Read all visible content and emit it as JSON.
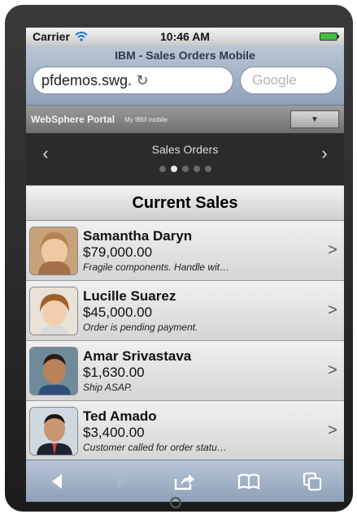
{
  "status": {
    "carrier": "Carrier",
    "time": "10:46 AM"
  },
  "browser": {
    "page_title": "IBM - Sales Orders Mobile",
    "url": "pfdemos.swg.usma.ib…",
    "search_placeholder": "Google"
  },
  "portal": {
    "brand": "WebSphere Portal",
    "subtitle": "My IBM mobile"
  },
  "nav": {
    "label": "Sales Orders",
    "active_page": 2,
    "page_count": 5
  },
  "section": {
    "title": "Current Sales"
  },
  "orders": [
    {
      "name": "Samantha Daryn",
      "amount": "$79,000.00",
      "note": "Fragile components. Handle wit…"
    },
    {
      "name": "Lucille Suarez",
      "amount": "$45,000.00",
      "note": "Order is pending payment."
    },
    {
      "name": "Amar Srivastava",
      "amount": "$1,630.00",
      "note": "Ship ASAP."
    },
    {
      "name": "Ted Amado",
      "amount": "$3,400.00",
      "note": "Customer called for order statu…"
    }
  ],
  "toolbar": {
    "icons": [
      "back-icon",
      "forward-icon",
      "share-icon",
      "bookmarks-icon",
      "tabs-icon"
    ]
  },
  "colors": {
    "accent": "#8fa1b8",
    "nav_bg": "#2b2b2b"
  }
}
